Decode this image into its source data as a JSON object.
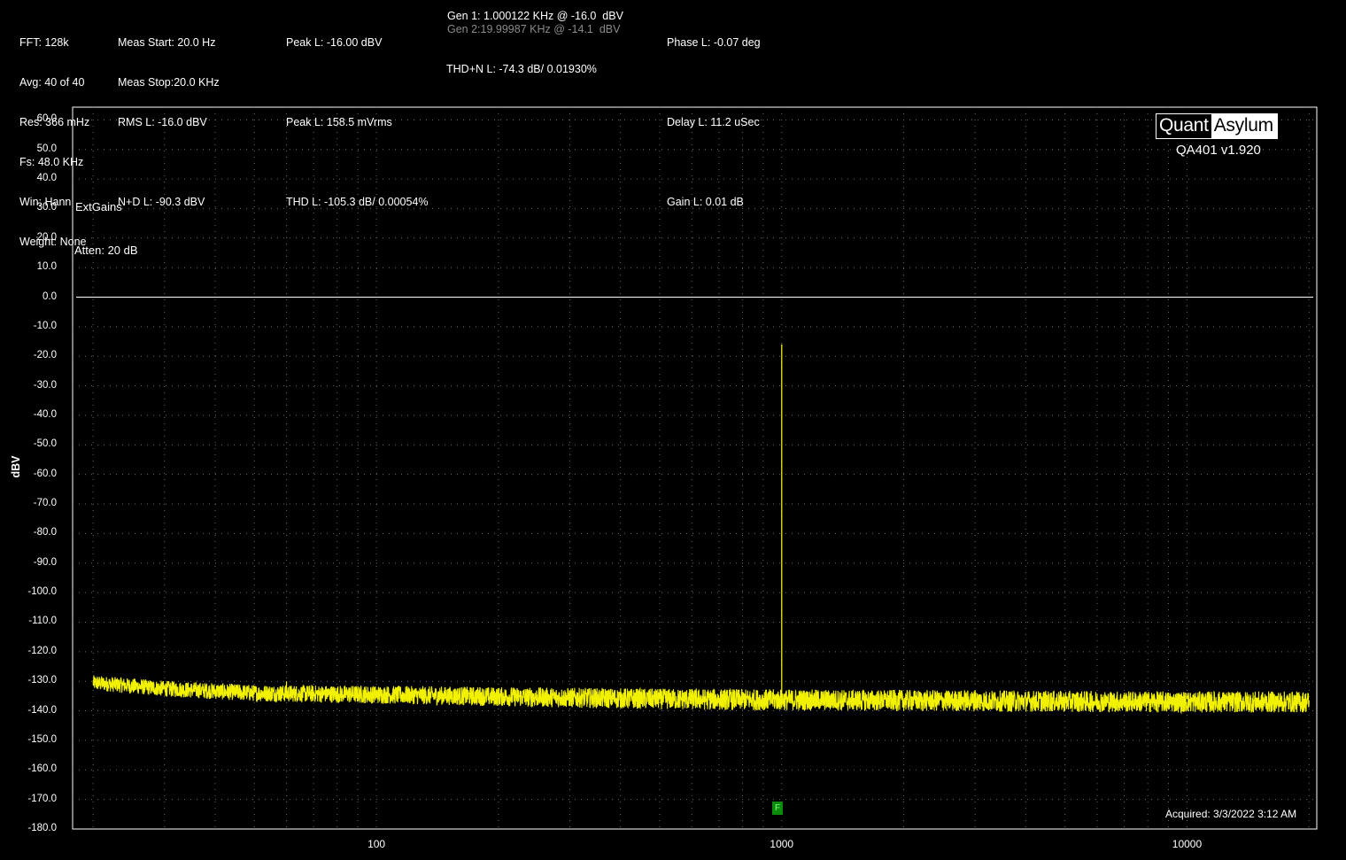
{
  "header": {
    "col1": [
      "FFT: 128k",
      "Avg: 40 of 40",
      "Res: 366 mHz",
      "Fs: 48.0 KHz",
      "Win: Hann",
      "Weight: None"
    ],
    "col2": [
      "Meas Start: 20.0 Hz",
      "Meas Stop:20.0 KHz",
      "RMS L: -16.0 dBV",
      "N+D L: -90.3 dBV"
    ],
    "col3": [
      "Peak L: -16.00 dBV",
      "Peak L: 158.5 mVrms",
      "THD L: -105.3 dB/ 0.00054%"
    ],
    "col4_gen1": "Gen 1: 1.000122 KHz @ -16.0  dBV",
    "col4_gen2": "Gen 2:19.99987 KHz @ -14.1  dBV",
    "col4_thdn": "THD+N L: -74.3 dB/ 0.01930%",
    "col5": [
      "Phase L: -0.07 deg",
      "Delay L: 11.2 uSec",
      "Gain L: 0.01 dB"
    ]
  },
  "annotations": {
    "extgains": "ExtGains",
    "atten": "Atten: 20 dB",
    "acquired": "Acquired: 3/3/2022  3:12 AM",
    "marker": "F"
  },
  "logo": {
    "left": "Quant",
    "right": "Asylum",
    "version": "QA401 v1.920"
  },
  "chart_data": {
    "type": "line",
    "ylabel": "dBV",
    "xlabel": "",
    "xscale": "log",
    "xlim": [
      20,
      20000
    ],
    "ylim": [
      -180,
      60
    ],
    "yticks": [
      "60.0",
      "50.0",
      "40.0",
      "30.0",
      "20.0",
      "10.0",
      "0.0",
      "-10.0",
      "-20.0",
      "-30.0",
      "-40.0",
      "-50.0",
      "-60.0",
      "-70.0",
      "-80.0",
      "-90.0",
      "-100.0",
      "-110.0",
      "-120.0",
      "-130.0",
      "-140.0",
      "-150.0",
      "-160.0",
      "-170.0",
      "-180.0"
    ],
    "xticks": [
      {
        "value": 100,
        "label": "100"
      },
      {
        "value": 1000,
        "label": "1000"
      },
      {
        "value": 10000,
        "label": "10000"
      }
    ],
    "reference_line_dbv": 0,
    "grid": true,
    "trace_color": "#ffff00",
    "series": [
      {
        "noise_floor": [
          [
            20,
            -130.5
          ],
          [
            30,
            -132.5
          ],
          [
            50,
            -134
          ],
          [
            100,
            -134.5
          ],
          [
            200,
            -135.2
          ],
          [
            500,
            -136
          ],
          [
            1000,
            -136.3
          ],
          [
            2000,
            -136.5
          ],
          [
            5000,
            -136.8
          ],
          [
            10000,
            -137
          ],
          [
            20000,
            -137
          ]
        ],
        "peaks": [
          [
            60,
            -130
          ],
          [
            180,
            -132
          ],
          [
            500,
            -133
          ],
          [
            1000,
            -16
          ],
          [
            3000,
            -133
          ],
          [
            10000,
            -134
          ]
        ]
      }
    ]
  }
}
